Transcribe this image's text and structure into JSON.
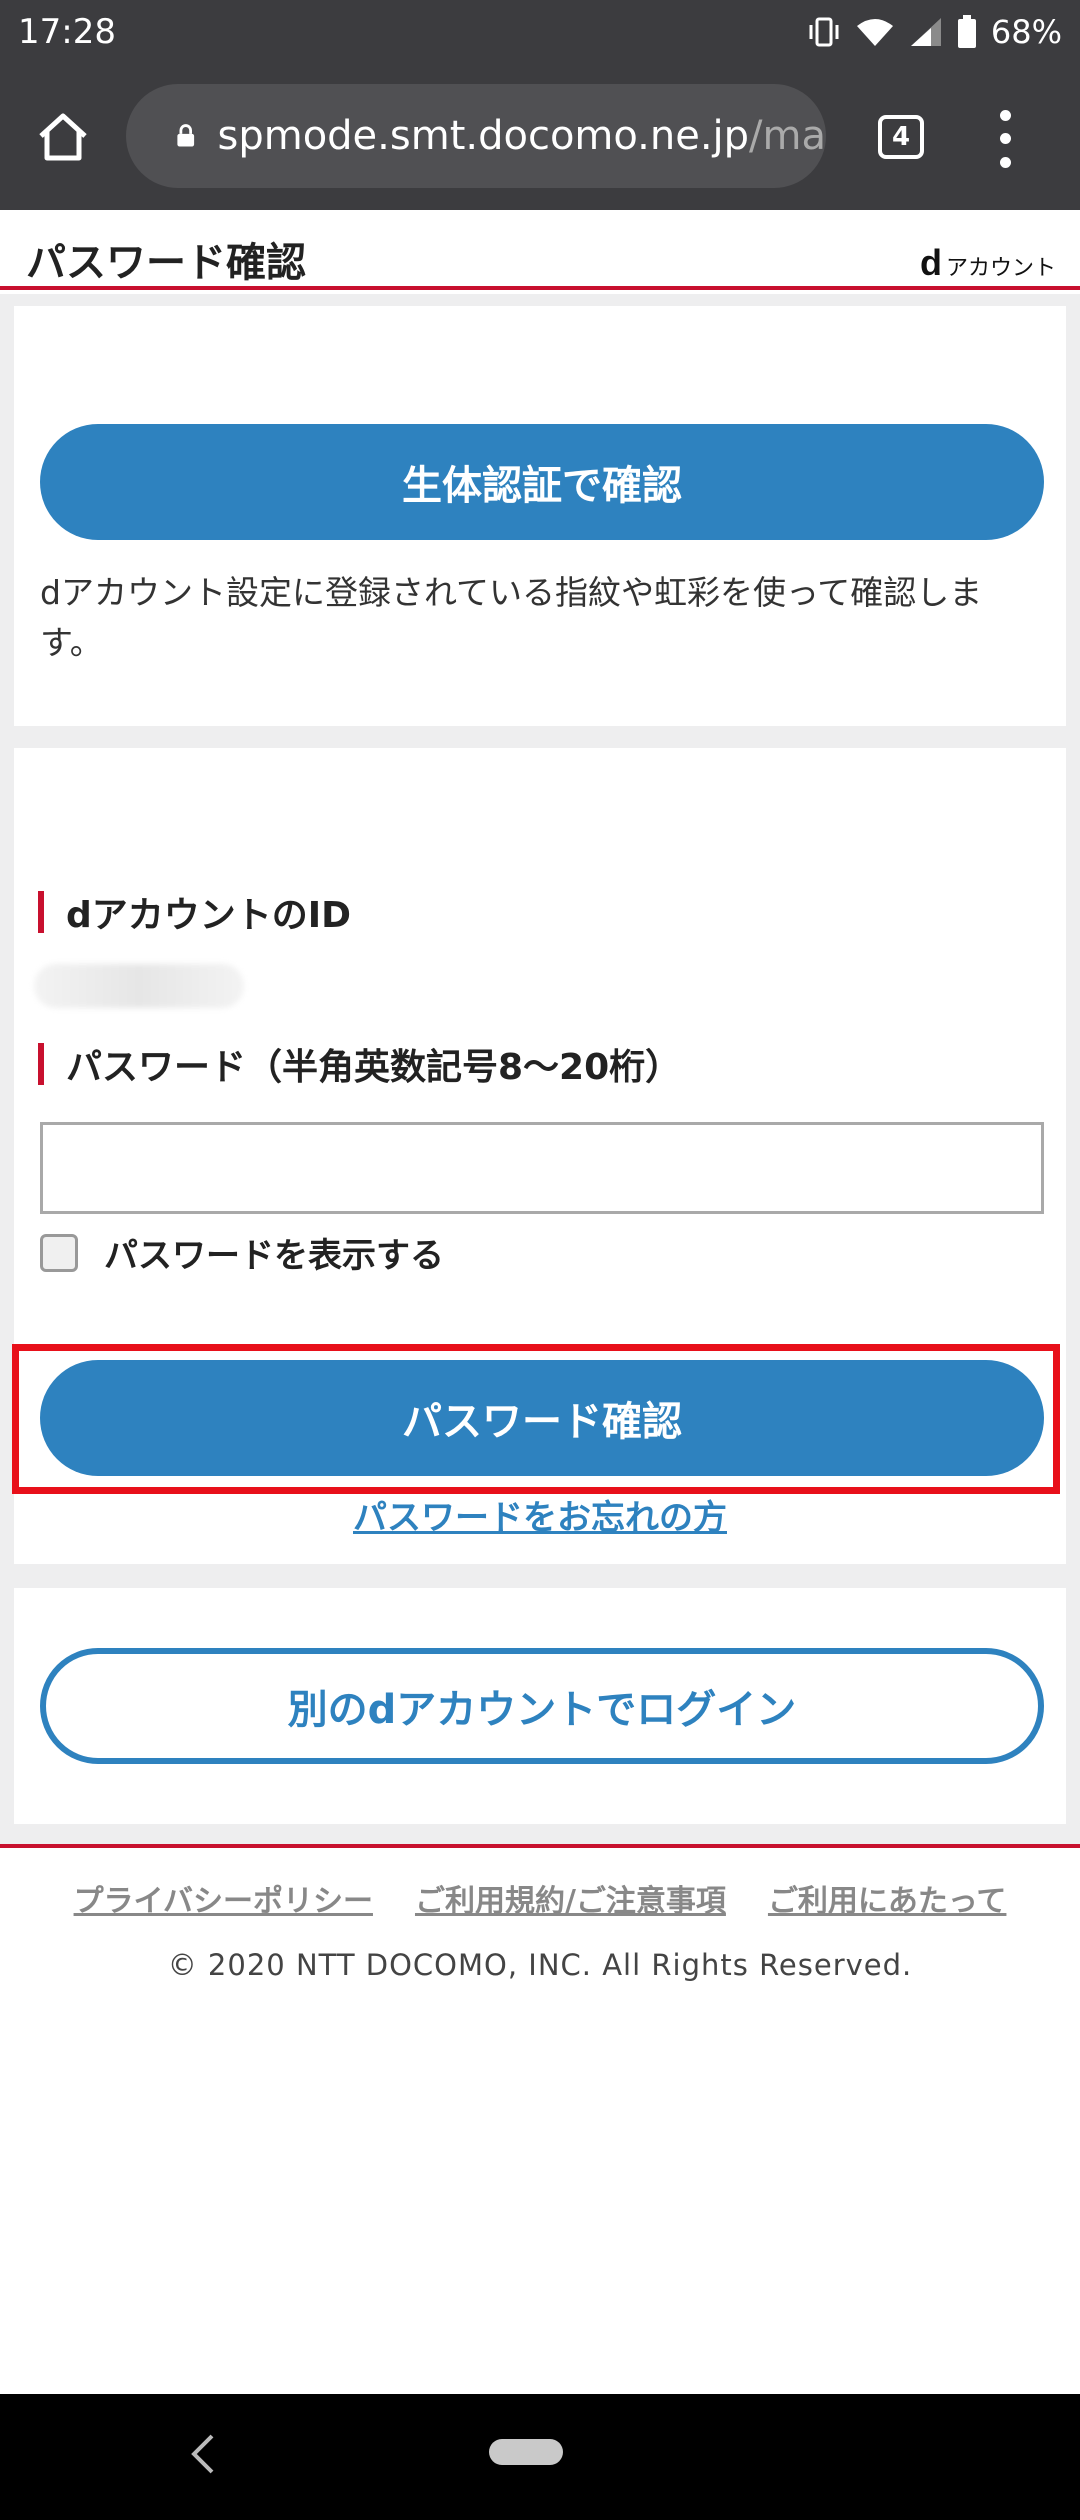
{
  "status_bar": {
    "time": "17:28",
    "battery": "68%"
  },
  "browser": {
    "url_main": "spmode.smt.docomo.ne.jp",
    "url_rest": "/ma",
    "tab_count": "4"
  },
  "header": {
    "title": "パスワード確認",
    "brand_mark": "d",
    "brand_text": "アカウント"
  },
  "biometric": {
    "button_label": "生体認証で確認",
    "description": "dアカウント設定に登録されている指紋や虹彩を使って確認します。"
  },
  "login_form": {
    "id_label": "dアカウントのID",
    "password_label": "パスワード（半角英数記号8～20桁）",
    "password_value": "",
    "show_password_label": "パスワードを表示する",
    "confirm_button_label": "パスワード確認",
    "forgot_link": "パスワードをお忘れの方"
  },
  "other_login": {
    "button_label": "別のdアカウントでログイン"
  },
  "footer": {
    "links": [
      "プライバシーポリシー",
      "ご利用規約/ご注意事項",
      "ご利用にあたって"
    ],
    "copyright": "© 2020 NTT DOCOMO, INC. All Rights Reserved."
  },
  "colors": {
    "accent_blue": "#2e82bf",
    "brand_red": "#c8102e",
    "highlight_red": "#e8101a"
  }
}
